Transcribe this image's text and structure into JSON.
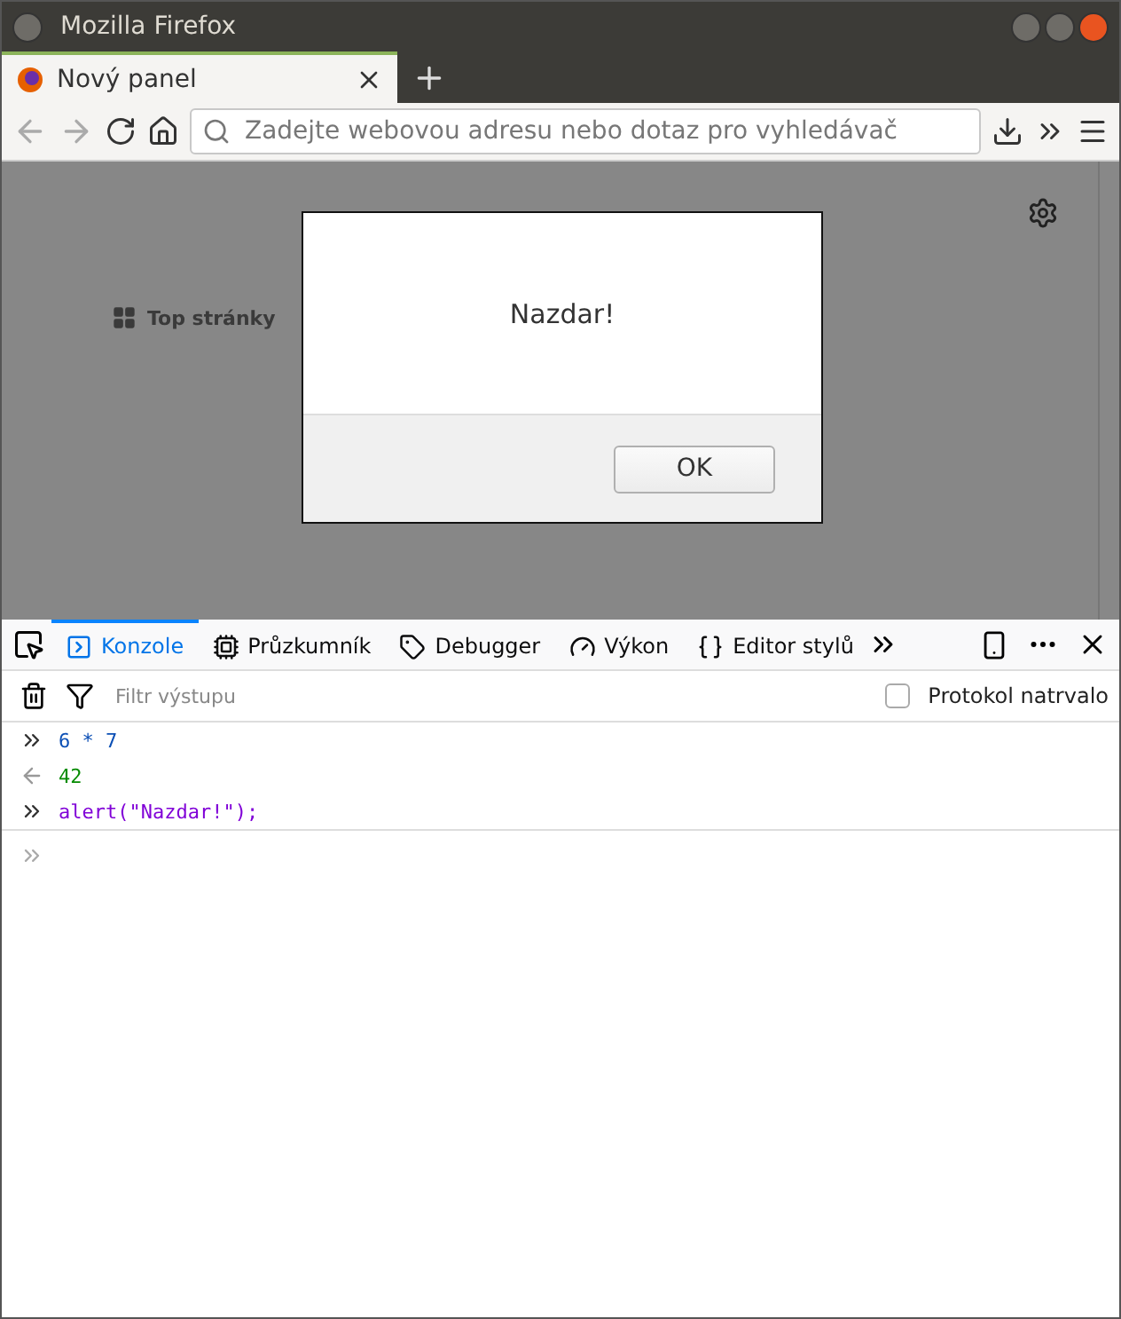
{
  "window": {
    "title": "Mozilla Firefox"
  },
  "tabs": [
    {
      "label": "Nový panel",
      "selected": true
    }
  ],
  "address_bar": {
    "placeholder": "Zadejte webovou adresu nebo dotaz pro vyhledávač"
  },
  "new_tab_page": {
    "top_sites_label": "Top stránky"
  },
  "dialog": {
    "message": "Nazdar!",
    "button": "OK"
  },
  "devtools": {
    "tabs": [
      {
        "label": "Konzole",
        "kind": "console",
        "selected": true
      },
      {
        "label": "Průzkumník",
        "kind": "inspector",
        "selected": false
      },
      {
        "label": "Debugger",
        "kind": "debugger",
        "selected": false
      },
      {
        "label": "Výkon",
        "kind": "performance",
        "selected": false
      },
      {
        "label": "Editor stylů",
        "kind": "style",
        "selected": false
      }
    ],
    "filter": {
      "placeholder": "Filtr výstupu"
    },
    "persist_logs": {
      "label": "Protokol natrvalo",
      "checked": false
    },
    "console": [
      {
        "kind": "input",
        "text": "6 * 7"
      },
      {
        "kind": "output",
        "text": "42"
      },
      {
        "kind": "call",
        "text": "alert(\"Nazdar!\");"
      }
    ]
  }
}
